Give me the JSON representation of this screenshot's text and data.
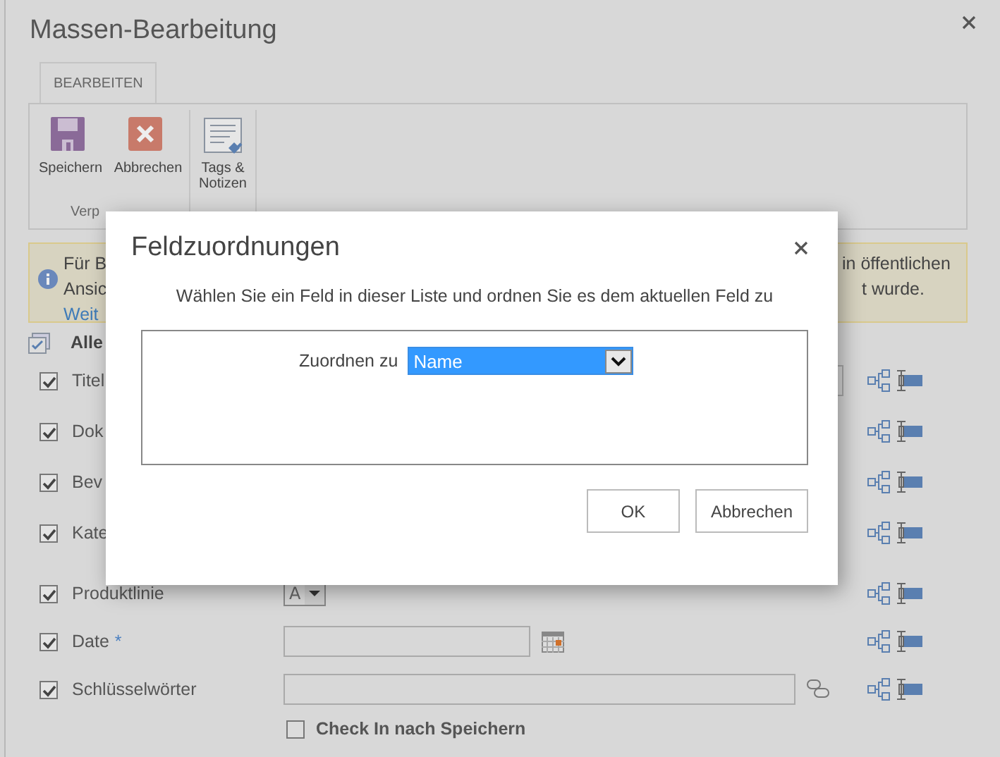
{
  "window": {
    "title": "Massen-Bearbeitung"
  },
  "ribbon": {
    "tabs": [
      {
        "label": "BEARBEITEN",
        "selected": true
      }
    ],
    "groups": [
      {
        "label": "Verp",
        "buttons": [
          {
            "label": "Speichern",
            "kind": "save"
          },
          {
            "label": "Abbrechen",
            "kind": "cancel"
          }
        ]
      },
      {
        "buttons": [
          {
            "label": "Tags & Notizen",
            "kind": "tags"
          }
        ]
      }
    ]
  },
  "info": {
    "lines": [
      "Für B",
      "Ansic"
    ],
    "link": "Weit",
    "right_lines": [
      "in öffentlichen",
      "t wurde."
    ]
  },
  "select_all": {
    "label": "Alle"
  },
  "fields": [
    {
      "label": "Titel",
      "checked": true,
      "kind": "text"
    },
    {
      "label": "Dok",
      "checked": true,
      "kind": "none"
    },
    {
      "label": "Bev",
      "checked": true,
      "kind": "none"
    },
    {
      "label": "Kate",
      "checked": true,
      "kind": "none"
    },
    {
      "label": "Produktlinie",
      "checked": true,
      "kind": "choice",
      "value": "A"
    },
    {
      "label": "Date",
      "checked": true,
      "kind": "date",
      "required_mark": "*"
    },
    {
      "label": "Schlüsselwörter",
      "checked": true,
      "kind": "keywords"
    }
  ],
  "check_in": {
    "label": "Check In nach Speichern",
    "checked": false
  },
  "dialog": {
    "title": "Feldzuordnungen",
    "instruction": "Wählen Sie ein Feld in dieser Liste und ordnen Sie es dem aktuellen Feld zu",
    "map_label": "Zuordnen zu",
    "map_value": "Name",
    "buttons": [
      "OK",
      "Abbrechen"
    ]
  }
}
